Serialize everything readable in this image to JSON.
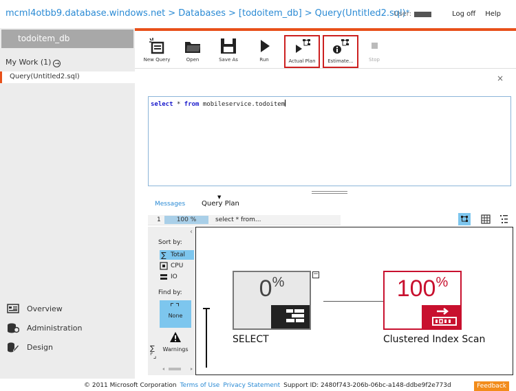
{
  "header": {
    "breadcrumb": [
      "mcml4otbb9.database.windows.net",
      "Databases",
      "[todoitem_db]",
      "Query(Untitled2.sql)"
    ],
    "separator": ">",
    "unsaved_marker": "*",
    "user_label": "User:",
    "logoff_label": "Log off",
    "help_label": "Help"
  },
  "sidebar": {
    "db_tab": "todoitem_db",
    "my_work_label": "My Work (1)",
    "my_work_arrow": "→",
    "query_item": "Query(Untitled2.sql)",
    "nav": [
      {
        "label": "Overview",
        "icon": "overview-icon"
      },
      {
        "label": "Administration",
        "icon": "administration-icon"
      },
      {
        "label": "Design",
        "icon": "design-icon"
      }
    ]
  },
  "toolbar": {
    "buttons": [
      {
        "label": "New Query",
        "icon": "new-query-icon",
        "highlight": false,
        "disabled": false
      },
      {
        "label": "Open",
        "icon": "open-folder-icon",
        "highlight": false,
        "disabled": false
      },
      {
        "label": "Save As",
        "icon": "save-icon",
        "highlight": false,
        "disabled": false
      },
      {
        "label": "Run",
        "icon": "run-icon",
        "highlight": false,
        "disabled": false
      },
      {
        "label": "Actual Plan",
        "icon": "actual-plan-icon",
        "highlight": true,
        "disabled": false
      },
      {
        "label": "Estimate...",
        "icon": "estimated-plan-icon",
        "highlight": true,
        "disabled": false
      },
      {
        "label": "Stop",
        "icon": "stop-icon",
        "highlight": false,
        "disabled": true
      }
    ],
    "close_symbol": "×"
  },
  "editor": {
    "keyword_select": "select",
    "star": "*",
    "keyword_from": "from",
    "table": "mobileservice.todoitem"
  },
  "results": {
    "tab_messages": "Messages",
    "tab_query_plan": "Query Plan",
    "statement_number": "1",
    "statement_percent": "100 %",
    "statement_text": "select * from..."
  },
  "left_panel": {
    "sort_by_label": "Sort by:",
    "sort_options": [
      {
        "label": "Total",
        "icon": "sigma-icon",
        "active": true
      },
      {
        "label": "CPU",
        "icon": "cpu-icon",
        "active": false
      },
      {
        "label": "IO",
        "icon": "io-icon",
        "active": false
      }
    ],
    "find_by_label": "Find by:",
    "find_none_label": "None",
    "warnings_label": "Warnings"
  },
  "plan": {
    "nodes": [
      {
        "id": "select",
        "percent": "0",
        "percent_sign": "%",
        "label": "SELECT",
        "icon": "select-operator-icon"
      },
      {
        "id": "scan",
        "percent": "100",
        "percent_sign": "%",
        "label": "Clustered Index Scan",
        "icon": "clustered-index-scan-icon"
      }
    ],
    "collapse_symbol": "−"
  },
  "footer": {
    "copyright": "© 2011 Microsoft Corporation",
    "terms": "Terms of Use",
    "privacy": "Privacy Statement",
    "support_id": "Support ID: 2480f743-206b-06bc-a148-ddbe9f2e773d",
    "feedback": "Feedback"
  },
  "colors": {
    "accent_orange": "#e8501a",
    "link_blue": "#2a8ad4",
    "highlight_red": "#cc1f1f",
    "active_blue": "#7dc6ee",
    "scan_red": "#c8102e"
  }
}
